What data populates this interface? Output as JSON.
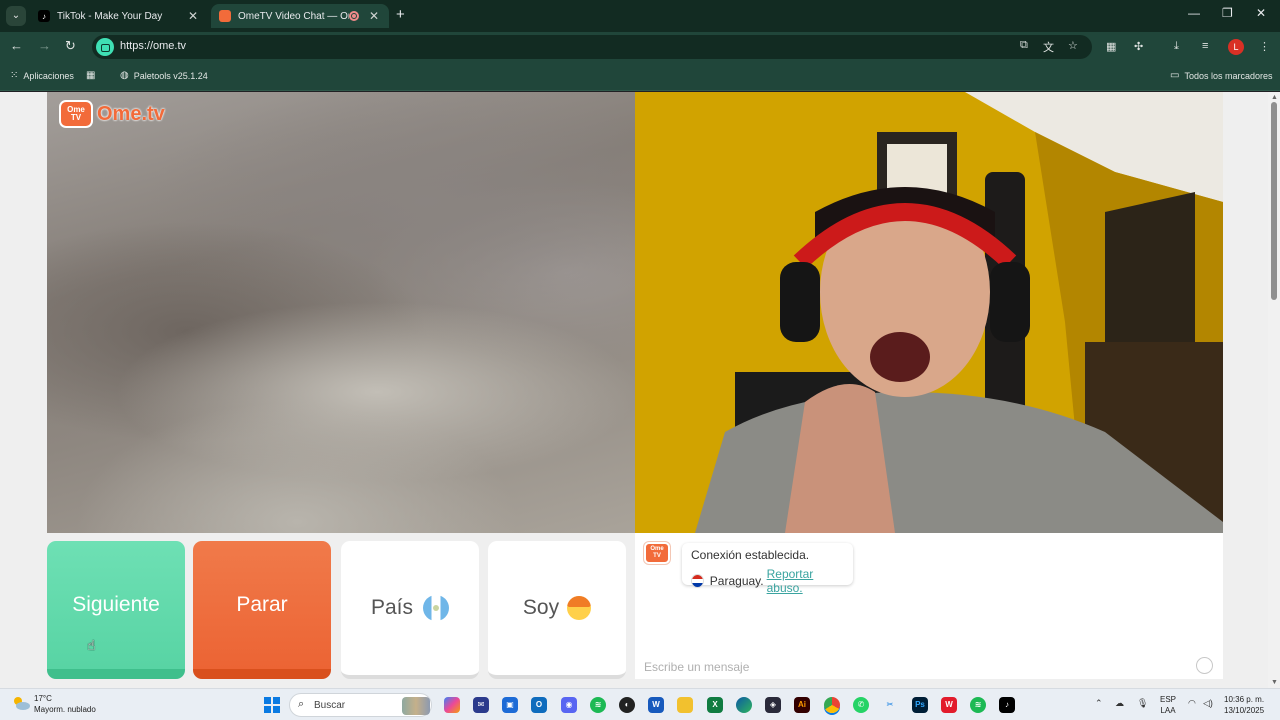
{
  "browser": {
    "tabs": [
      {
        "title": "TikTok - Make Your Day",
        "active": false
      },
      {
        "title": "OmeTV Video Chat — Omegle",
        "active": true
      }
    ],
    "url": "https://ome.tv",
    "bookmarks": [
      {
        "label": "Aplicaciones",
        "icon": "apps-grid-icon"
      },
      {
        "label": "",
        "icon": "grid-icon"
      },
      {
        "label": "Paletools v25.1.24",
        "icon": "globe-icon"
      }
    ],
    "all_bookmarks_label": "Todos los marcadores",
    "profile_initial": "L"
  },
  "page": {
    "logo": {
      "badge": "Ome TV",
      "wordmark": "Ome.tv"
    },
    "controls": {
      "next_label": "Siguiente",
      "stop_label": "Parar",
      "country_label": "País",
      "gender_label": "Soy"
    },
    "chat": {
      "logo_badge": "Ome TV",
      "status": "Conexión establecida.",
      "country": "Paraguay.",
      "report_link": "Reportar abuso.",
      "input_placeholder": "Escribe un mensaje"
    }
  },
  "taskbar": {
    "weather": {
      "temp": "17°C",
      "condition": "Mayorm. nublado"
    },
    "search_placeholder": "Buscar",
    "language": {
      "code": "ESP",
      "layout": "LAA"
    },
    "time": "10:36 p. m.",
    "date": "13/10/2025"
  },
  "colors": {
    "accent_green": "#58d4a4",
    "accent_orange": "#ec6434",
    "browser_frame": "#20463a",
    "link": "#3aa4a0"
  }
}
